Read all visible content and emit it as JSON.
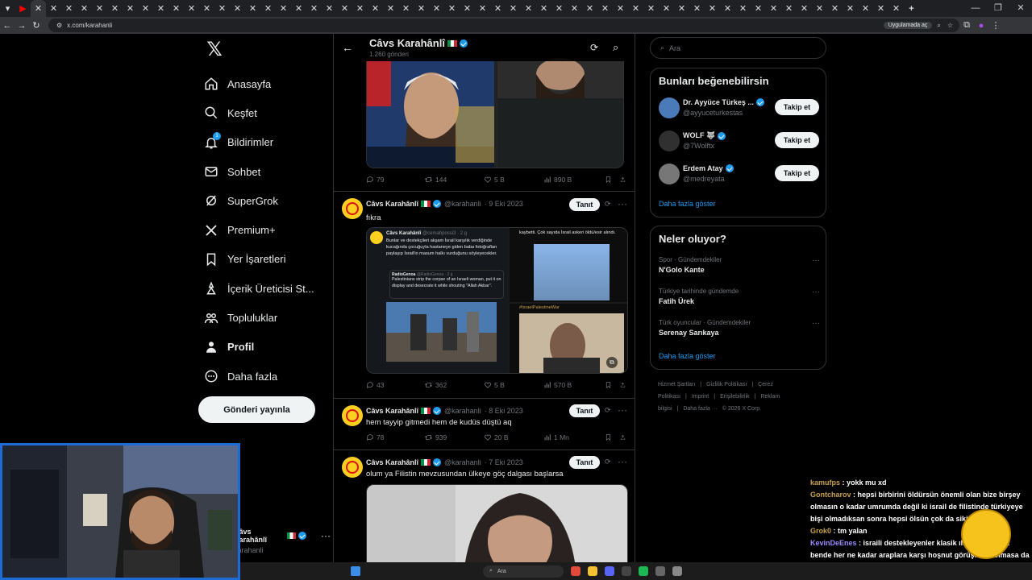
{
  "browser": {
    "tab_count": 58,
    "url": "x.com/karahanli",
    "open_in_app": "Uygulamada aç"
  },
  "nav": {
    "items": [
      {
        "label": "Anasayfa",
        "icon": "home-icon"
      },
      {
        "label": "Keşfet",
        "icon": "search-icon"
      },
      {
        "label": "Bildirimler",
        "icon": "bell-icon",
        "badge": "1"
      },
      {
        "label": "Sohbet",
        "icon": "mail-icon"
      },
      {
        "label": "SuperGrok",
        "icon": "grok-icon"
      },
      {
        "label": "Premium+",
        "icon": "x-logo-icon"
      },
      {
        "label": "Yer İşaretleri",
        "icon": "bookmark-icon"
      },
      {
        "label": "İçerik Üreticisi St...",
        "icon": "creator-studio-icon"
      },
      {
        "label": "Topluluklar",
        "icon": "communities-icon"
      },
      {
        "label": "Profil",
        "icon": "profile-icon"
      },
      {
        "label": "Daha fazla",
        "icon": "more-circle-icon"
      }
    ],
    "post_button": "Gönderi yayınla",
    "account_name": "Câvs Karahânlî",
    "account_handle": "karahanli"
  },
  "profile_header": {
    "name": "Câvs Karahânlî",
    "post_count": "1.260 gönderi"
  },
  "tweets": [
    {
      "stats": {
        "replies": "79",
        "reposts": "144",
        "likes": "5 B",
        "views": "890 B"
      }
    },
    {
      "name": "Câvs Karahânlî",
      "handle": "@karahanli",
      "date": "· 9 Eki 2023",
      "tanit": "Tanıt",
      "text": "fıkra",
      "quoted": {
        "name": "Câvs Karahânlî",
        "handle": "@cemahpossi3 · 2 g",
        "text": "Bunlar ve destekçileri akşam İsrail karşılık verdiğinde kucağında çocuğuyla hastaneye giden baba fotoğrafları paylaşıp İsrail'in masum halkı vurduğunu söyleyecekler.",
        "inner_name": "RadioGenoa",
        "inner_handle": "@RadioGenoa · 2 g",
        "inner_text": "Palestinians strip the corpse of an Israeli woman, put it on display and desecrate it while shouting \"Allah Akbar\".",
        "right_text": "kaybetti. Çok sayıda İsrail askeri öldü/esir alındı.",
        "hashtag": "#IsraelPalestineWar"
      },
      "stats": {
        "replies": "43",
        "reposts": "362",
        "likes": "5 B",
        "views": "570 B"
      }
    },
    {
      "name": "Câvs Karahânlî",
      "handle": "@karahanli",
      "date": "· 8 Eki 2023",
      "tanit": "Tanıt",
      "text": "hem tayyip gitmedi hem de kudüs düştü aq",
      "stats": {
        "replies": "78",
        "reposts": "939",
        "likes": "20 B",
        "views": "1 Mn"
      }
    },
    {
      "name": "Câvs Karahânlî",
      "handle": "@karahanli",
      "date": "· 7 Eki 2023",
      "tanit": "Tanıt",
      "text": "olum ya Filistin mevzusundan ülkeye göç dalgası başlarsa"
    }
  ],
  "right": {
    "search_placeholder": "Ara",
    "suggest_title": "Bunları beğenebilirsin",
    "follow_label": "Takip et",
    "suggestions": [
      {
        "name": "Dr. Ayyüce Türkeş ...",
        "handle": "@ayyuceturkestas"
      },
      {
        "name": "WOLF 🐺",
        "handle": "@7Wolftx"
      },
      {
        "name": "Erdem Atay",
        "handle": "@medreyata"
      }
    ],
    "show_more": "Daha fazla göster",
    "trends_title": "Neler oluyor?",
    "trends": [
      {
        "category": "Spor · Gündemdekiler",
        "title": "N'Golo Kante"
      },
      {
        "category": "Türkiye tarihinde gündemde",
        "title": "Fatih Ürek"
      },
      {
        "category": "Türk oyuncular · Gündemdekiler",
        "title": "Serenay Sarıkaya"
      }
    ],
    "footer": [
      "Hizmet Şartları",
      "|",
      "Gizlilik Politikası",
      "|",
      "Çerez Politikası",
      "|",
      "Imprint",
      "|",
      "Erişilebilirlik",
      "|",
      "Reklam bilgisi",
      "|",
      "Daha fazla ···",
      "© 2026 X Corp."
    ]
  },
  "chat": [
    {
      "user": "kamufps",
      "text": "yokk mu xd"
    },
    {
      "user": "Gontcharov",
      "text": "hepsi birbirini öldürsün önemli olan bize birşey olmasın o kadar umrumda değil ki israil de filistinde türkiyeye bişi olmadıksan sonra hepsi ölsün çok da sikimde"
    },
    {
      "user": "Grok0",
      "text": "tm yalan"
    },
    {
      "user": "KevinDeEnes",
      "text": "israili destekleyenler klasik ılık geliurateist bende her ne kadar araplara karşı hoşnut görüşlerim olmasa da sırf arapları sevmiyor diye israili tutan tipler haci"
    }
  ],
  "taskbar": {
    "search": "Ara"
  }
}
